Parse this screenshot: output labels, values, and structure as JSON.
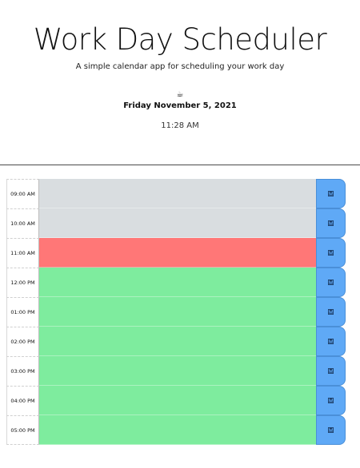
{
  "header": {
    "title": "Work Day Scheduler",
    "subtitle": "A simple calendar app for scheduling your work day",
    "coffee_icon": "☕",
    "date": "Friday November 5, 2021",
    "time": "11:28 AM"
  },
  "colors": {
    "past": "#d9dde0",
    "present": "#ff7777",
    "future": "#7eec9e",
    "save": "#5fa9f6"
  },
  "rows": [
    {
      "hour": "09:00 AM",
      "state": "past",
      "text": "",
      "save_icon": "save-icon"
    },
    {
      "hour": "10:00 AM",
      "state": "past",
      "text": "",
      "save_icon": "save-icon"
    },
    {
      "hour": "11:00 AM",
      "state": "present",
      "text": "",
      "save_icon": "save-icon"
    },
    {
      "hour": "12:00 PM",
      "state": "future",
      "text": "",
      "save_icon": "save-icon"
    },
    {
      "hour": "01:00 PM",
      "state": "future",
      "text": "",
      "save_icon": "save-icon"
    },
    {
      "hour": "02:00 PM",
      "state": "future",
      "text": "",
      "save_icon": "save-icon"
    },
    {
      "hour": "03:00 PM",
      "state": "future",
      "text": "",
      "save_icon": "save-icon"
    },
    {
      "hour": "04:00 PM",
      "state": "future",
      "text": "",
      "save_icon": "save-icon"
    },
    {
      "hour": "05:00 PM",
      "state": "future",
      "text": "",
      "save_icon": "save-icon"
    }
  ]
}
